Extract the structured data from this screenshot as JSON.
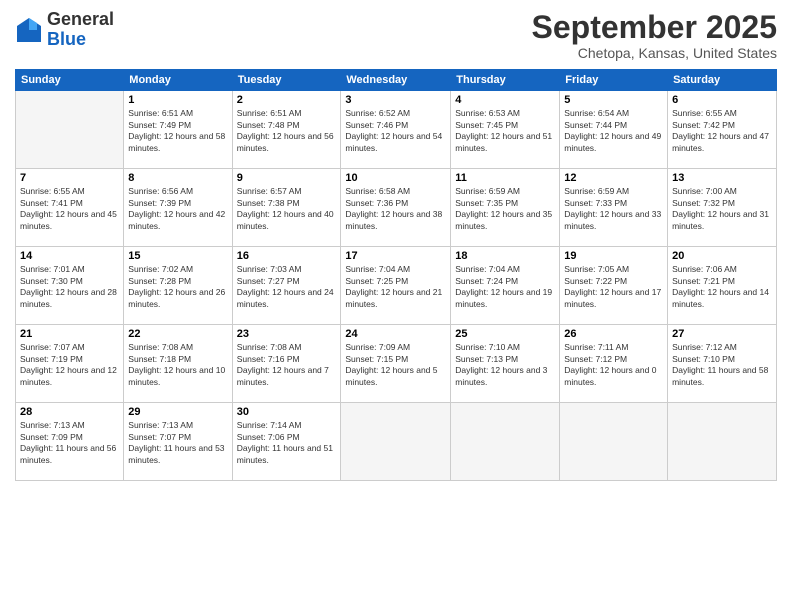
{
  "header": {
    "logo_general": "General",
    "logo_blue": "Blue",
    "month_title": "September 2025",
    "subtitle": "Chetopa, Kansas, United States"
  },
  "columns": [
    "Sunday",
    "Monday",
    "Tuesday",
    "Wednesday",
    "Thursday",
    "Friday",
    "Saturday"
  ],
  "weeks": [
    [
      {
        "day": "",
        "sunrise": "",
        "sunset": "",
        "daylight": "",
        "empty": true
      },
      {
        "day": "1",
        "sunrise": "Sunrise: 6:51 AM",
        "sunset": "Sunset: 7:49 PM",
        "daylight": "Daylight: 12 hours and 58 minutes."
      },
      {
        "day": "2",
        "sunrise": "Sunrise: 6:51 AM",
        "sunset": "Sunset: 7:48 PM",
        "daylight": "Daylight: 12 hours and 56 minutes."
      },
      {
        "day": "3",
        "sunrise": "Sunrise: 6:52 AM",
        "sunset": "Sunset: 7:46 PM",
        "daylight": "Daylight: 12 hours and 54 minutes."
      },
      {
        "day": "4",
        "sunrise": "Sunrise: 6:53 AM",
        "sunset": "Sunset: 7:45 PM",
        "daylight": "Daylight: 12 hours and 51 minutes."
      },
      {
        "day": "5",
        "sunrise": "Sunrise: 6:54 AM",
        "sunset": "Sunset: 7:44 PM",
        "daylight": "Daylight: 12 hours and 49 minutes."
      },
      {
        "day": "6",
        "sunrise": "Sunrise: 6:55 AM",
        "sunset": "Sunset: 7:42 PM",
        "daylight": "Daylight: 12 hours and 47 minutes."
      }
    ],
    [
      {
        "day": "7",
        "sunrise": "Sunrise: 6:55 AM",
        "sunset": "Sunset: 7:41 PM",
        "daylight": "Daylight: 12 hours and 45 minutes."
      },
      {
        "day": "8",
        "sunrise": "Sunrise: 6:56 AM",
        "sunset": "Sunset: 7:39 PM",
        "daylight": "Daylight: 12 hours and 42 minutes."
      },
      {
        "day": "9",
        "sunrise": "Sunrise: 6:57 AM",
        "sunset": "Sunset: 7:38 PM",
        "daylight": "Daylight: 12 hours and 40 minutes."
      },
      {
        "day": "10",
        "sunrise": "Sunrise: 6:58 AM",
        "sunset": "Sunset: 7:36 PM",
        "daylight": "Daylight: 12 hours and 38 minutes."
      },
      {
        "day": "11",
        "sunrise": "Sunrise: 6:59 AM",
        "sunset": "Sunset: 7:35 PM",
        "daylight": "Daylight: 12 hours and 35 minutes."
      },
      {
        "day": "12",
        "sunrise": "Sunrise: 6:59 AM",
        "sunset": "Sunset: 7:33 PM",
        "daylight": "Daylight: 12 hours and 33 minutes."
      },
      {
        "day": "13",
        "sunrise": "Sunrise: 7:00 AM",
        "sunset": "Sunset: 7:32 PM",
        "daylight": "Daylight: 12 hours and 31 minutes."
      }
    ],
    [
      {
        "day": "14",
        "sunrise": "Sunrise: 7:01 AM",
        "sunset": "Sunset: 7:30 PM",
        "daylight": "Daylight: 12 hours and 28 minutes."
      },
      {
        "day": "15",
        "sunrise": "Sunrise: 7:02 AM",
        "sunset": "Sunset: 7:28 PM",
        "daylight": "Daylight: 12 hours and 26 minutes."
      },
      {
        "day": "16",
        "sunrise": "Sunrise: 7:03 AM",
        "sunset": "Sunset: 7:27 PM",
        "daylight": "Daylight: 12 hours and 24 minutes."
      },
      {
        "day": "17",
        "sunrise": "Sunrise: 7:04 AM",
        "sunset": "Sunset: 7:25 PM",
        "daylight": "Daylight: 12 hours and 21 minutes."
      },
      {
        "day": "18",
        "sunrise": "Sunrise: 7:04 AM",
        "sunset": "Sunset: 7:24 PM",
        "daylight": "Daylight: 12 hours and 19 minutes."
      },
      {
        "day": "19",
        "sunrise": "Sunrise: 7:05 AM",
        "sunset": "Sunset: 7:22 PM",
        "daylight": "Daylight: 12 hours and 17 minutes."
      },
      {
        "day": "20",
        "sunrise": "Sunrise: 7:06 AM",
        "sunset": "Sunset: 7:21 PM",
        "daylight": "Daylight: 12 hours and 14 minutes."
      }
    ],
    [
      {
        "day": "21",
        "sunrise": "Sunrise: 7:07 AM",
        "sunset": "Sunset: 7:19 PM",
        "daylight": "Daylight: 12 hours and 12 minutes."
      },
      {
        "day": "22",
        "sunrise": "Sunrise: 7:08 AM",
        "sunset": "Sunset: 7:18 PM",
        "daylight": "Daylight: 12 hours and 10 minutes."
      },
      {
        "day": "23",
        "sunrise": "Sunrise: 7:08 AM",
        "sunset": "Sunset: 7:16 PM",
        "daylight": "Daylight: 12 hours and 7 minutes."
      },
      {
        "day": "24",
        "sunrise": "Sunrise: 7:09 AM",
        "sunset": "Sunset: 7:15 PM",
        "daylight": "Daylight: 12 hours and 5 minutes."
      },
      {
        "day": "25",
        "sunrise": "Sunrise: 7:10 AM",
        "sunset": "Sunset: 7:13 PM",
        "daylight": "Daylight: 12 hours and 3 minutes."
      },
      {
        "day": "26",
        "sunrise": "Sunrise: 7:11 AM",
        "sunset": "Sunset: 7:12 PM",
        "daylight": "Daylight: 12 hours and 0 minutes."
      },
      {
        "day": "27",
        "sunrise": "Sunrise: 7:12 AM",
        "sunset": "Sunset: 7:10 PM",
        "daylight": "Daylight: 11 hours and 58 minutes."
      }
    ],
    [
      {
        "day": "28",
        "sunrise": "Sunrise: 7:13 AM",
        "sunset": "Sunset: 7:09 PM",
        "daylight": "Daylight: 11 hours and 56 minutes."
      },
      {
        "day": "29",
        "sunrise": "Sunrise: 7:13 AM",
        "sunset": "Sunset: 7:07 PM",
        "daylight": "Daylight: 11 hours and 53 minutes."
      },
      {
        "day": "30",
        "sunrise": "Sunrise: 7:14 AM",
        "sunset": "Sunset: 7:06 PM",
        "daylight": "Daylight: 11 hours and 51 minutes."
      },
      {
        "day": "",
        "sunrise": "",
        "sunset": "",
        "daylight": "",
        "empty": true
      },
      {
        "day": "",
        "sunrise": "",
        "sunset": "",
        "daylight": "",
        "empty": true
      },
      {
        "day": "",
        "sunrise": "",
        "sunset": "",
        "daylight": "",
        "empty": true
      },
      {
        "day": "",
        "sunrise": "",
        "sunset": "",
        "daylight": "",
        "empty": true
      }
    ]
  ]
}
